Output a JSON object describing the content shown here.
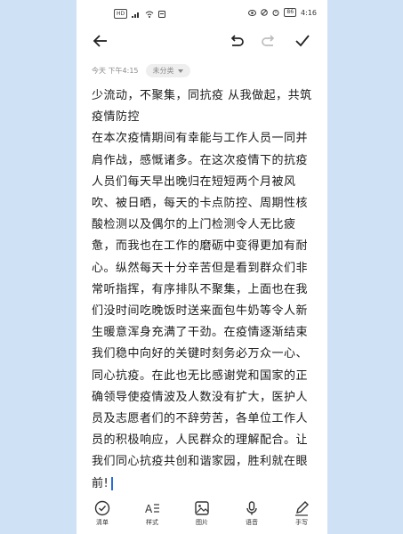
{
  "status": {
    "left_icons": [
      "sim-hd-badge",
      "signal",
      "wifi",
      "notification"
    ],
    "left_text": "HD",
    "battery": "86",
    "time": "4:16"
  },
  "toolbar": {
    "back": "back-arrow-icon",
    "undo": "undo-icon",
    "redo": "redo-icon",
    "done": "check-icon"
  },
  "meta": {
    "date": "今天 下午4:15",
    "category": "未分类"
  },
  "note": {
    "title": "少流动，不聚集，同抗疫 从我做起，共筑疫情防控",
    "body": "在本次疫情期间有幸能与工作人员一同并肩作战，感慨诸多。在这次疫情下的抗疫人员们每天早出晚归在短短两个月被风吹、被日晒，每天的卡点防控、周期性核酸检测以及偶尔的上门检测令人无比疲惫，而我也在工作的磨砺中变得更加有耐心。纵然每天十分辛苦但是看到群众们非常听指挥，有序排队不聚集，上面也在我们没时间吃晚饭时送来面包牛奶等令人新生暖意浑身充满了干劲。在疫情逐渐结束我们稳中向好的关键时刻务必万众一心、同心抗疫。在此也无比感谢党和国家的正确领导使疫情波及人数没有扩大，医护人员及志愿者们的不辞劳苦，各单位工作人员的积极响应，人民群众的理解配合。让我们同心抗疫共创和谐家园，胜利就在眼前!"
  },
  "bottom": {
    "items": [
      {
        "label": "清单",
        "icon": "checklist-icon"
      },
      {
        "label": "样式",
        "icon": "text-style-icon"
      },
      {
        "label": "图片",
        "icon": "image-icon"
      },
      {
        "label": "语音",
        "icon": "microphone-icon"
      },
      {
        "label": "手写",
        "icon": "pen-icon"
      }
    ]
  }
}
